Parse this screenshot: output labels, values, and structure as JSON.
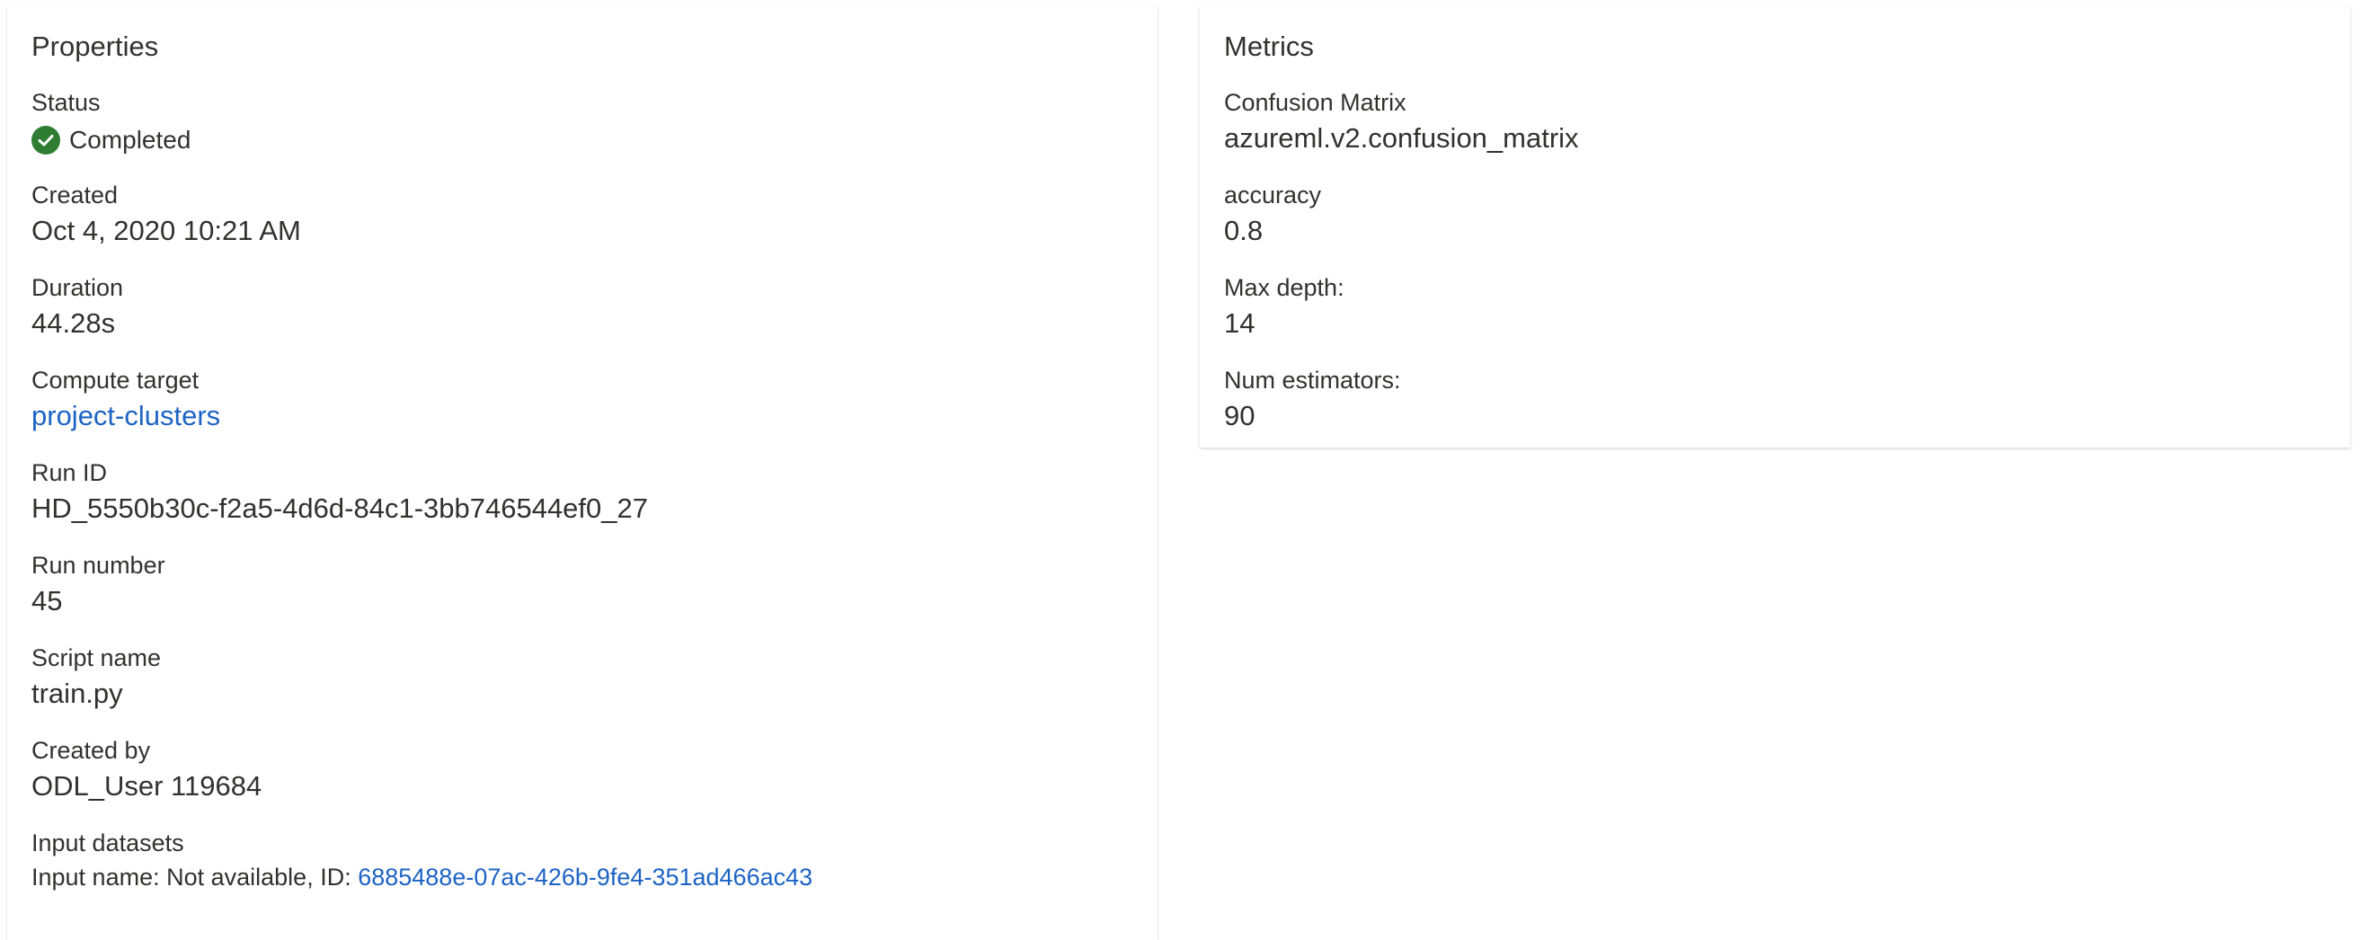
{
  "properties": {
    "title": "Properties",
    "status": {
      "label": "Status",
      "value": "Completed",
      "icon": "check-circle-icon",
      "color": "#2e7d32"
    },
    "created": {
      "label": "Created",
      "value": "Oct 4, 2020 10:21 AM"
    },
    "duration": {
      "label": "Duration",
      "value": "44.28s"
    },
    "compute_target": {
      "label": "Compute target",
      "value": "project-clusters"
    },
    "run_id": {
      "label": "Run ID",
      "value": "HD_5550b30c-f2a5-4d6d-84c1-3bb746544ef0_27"
    },
    "run_number": {
      "label": "Run number",
      "value": "45"
    },
    "script_name": {
      "label": "Script name",
      "value": "train.py"
    },
    "created_by": {
      "label": "Created by",
      "value": "ODL_User 119684"
    },
    "input_datasets": {
      "label": "Input datasets",
      "prefix": "Input name: Not available, ID: ",
      "id": "6885488e-07ac-426b-9fe4-351ad466ac43"
    }
  },
  "metrics": {
    "title": "Metrics",
    "items": [
      {
        "label": "Confusion Matrix",
        "value": "azureml.v2.confusion_matrix"
      },
      {
        "label": "accuracy",
        "value": "0.8"
      },
      {
        "label": "Max depth:",
        "value": "14"
      },
      {
        "label": "Num estimators:",
        "value": "90"
      }
    ]
  },
  "colors": {
    "link": "#1d63c5",
    "text": "#323130",
    "success": "#2e7d32"
  }
}
